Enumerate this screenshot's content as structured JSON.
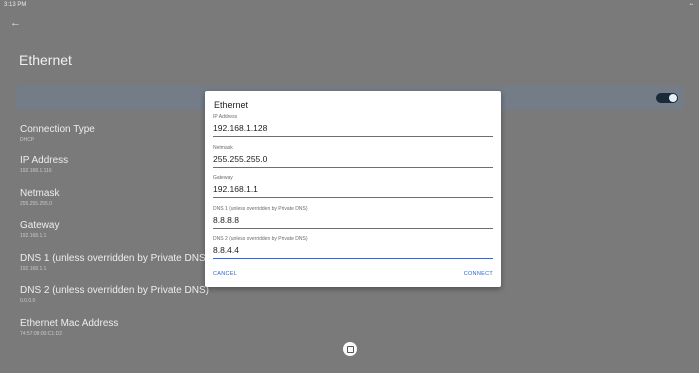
{
  "status_bar": {
    "time": "3:13 PM",
    "indicators": "••"
  },
  "header": {
    "back_icon": "arrow-back-icon",
    "title": "Ethernet"
  },
  "toggle": {
    "state": "on",
    "accent": "#1b2a3a"
  },
  "settings": [
    {
      "name": "Connection Type",
      "value": "DHCP"
    },
    {
      "name": "IP Address",
      "value": "192.168.1.116"
    },
    {
      "name": "Netmask",
      "value": "255.255.255.0"
    },
    {
      "name": "Gateway",
      "value": "192.168.1.1"
    },
    {
      "name": "DNS 1 (unless overridden by Private DNS)",
      "value": "192.168.1.1"
    },
    {
      "name": "DNS 2 (unless overridden by Private DNS)",
      "value": "0.0.0.0"
    },
    {
      "name": "Ethernet Mac Address",
      "value": "74:57:08:00:C1:D2"
    }
  ],
  "dialog": {
    "title": "Ethernet",
    "fields": [
      {
        "label": "IP Address",
        "value": "192.168.1.128"
      },
      {
        "label": "Netmask",
        "value": "255.255.255.0"
      },
      {
        "label": "Gateway",
        "value": "192.168.1.1"
      },
      {
        "label": "DNS 1 (unless overridden by Private DNS)",
        "value": "8.8.8.8"
      },
      {
        "label": "DNS 2 (unless overridden by Private DNS)",
        "value": "8.8.4.4"
      }
    ],
    "cancel_label": "CANCEL",
    "connect_label": "CONNECT"
  },
  "nav": {
    "home_icon": "home-square-icon"
  }
}
